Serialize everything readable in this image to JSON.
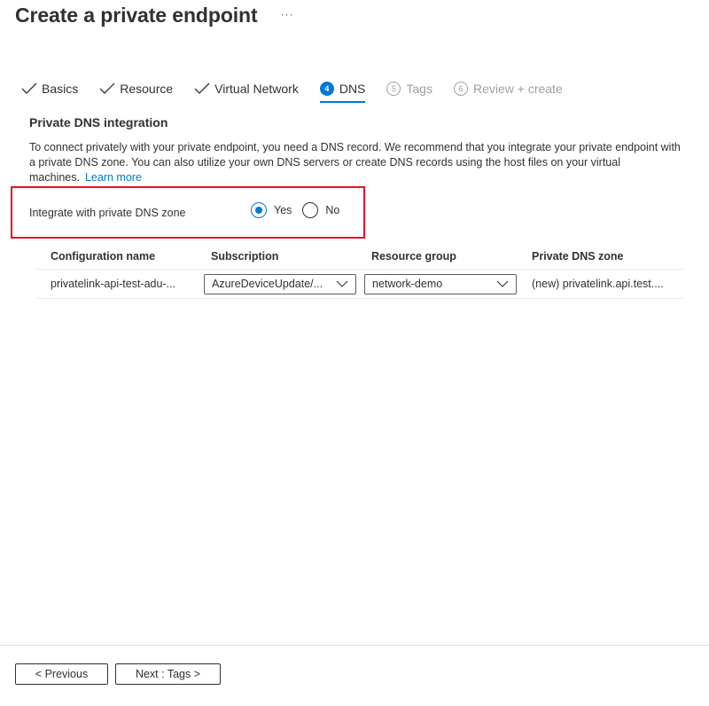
{
  "header": {
    "title": "Create a private endpoint",
    "more_label": "···"
  },
  "tabs": [
    {
      "label": "Basics",
      "state": "completed",
      "icon": "checkmark-icon"
    },
    {
      "label": "Resource",
      "state": "completed",
      "icon": "checkmark-icon"
    },
    {
      "label": "Virtual Network",
      "state": "completed",
      "icon": "checkmark-icon"
    },
    {
      "label": "DNS",
      "state": "active",
      "number": "4"
    },
    {
      "label": "Tags",
      "state": "disabled",
      "number": "5"
    },
    {
      "label": "Review + create",
      "state": "disabled",
      "number": "6"
    }
  ],
  "section": {
    "title": "Private DNS integration",
    "description": "To connect privately with your private endpoint, you need a DNS record. We recommend that you integrate your private endpoint with a private DNS zone. You can also utilize your own DNS servers or create DNS records using the host files on your virtual machines.",
    "learn_more": "Learn more"
  },
  "integrate": {
    "label": "Integrate with private DNS zone",
    "options": [
      {
        "label": "Yes",
        "selected": true
      },
      {
        "label": "No",
        "selected": false
      }
    ]
  },
  "grid": {
    "columns": [
      "Configuration name",
      "Subscription",
      "Resource group",
      "Private DNS zone"
    ],
    "rows": [
      {
        "configuration_name": "privatelink-api-test-adu-...",
        "subscription": "AzureDeviceUpdate/...",
        "resource_group": "network-demo",
        "private_dns_zone": "(new) privatelink.api.test...."
      }
    ]
  },
  "footer": {
    "previous_label": "< Previous",
    "next_label": "Next : Tags >"
  },
  "colors": {
    "accent": "#0078d4",
    "highlight_border": "#e81123",
    "text": "#323130",
    "disabled_text": "#a19f9d"
  }
}
